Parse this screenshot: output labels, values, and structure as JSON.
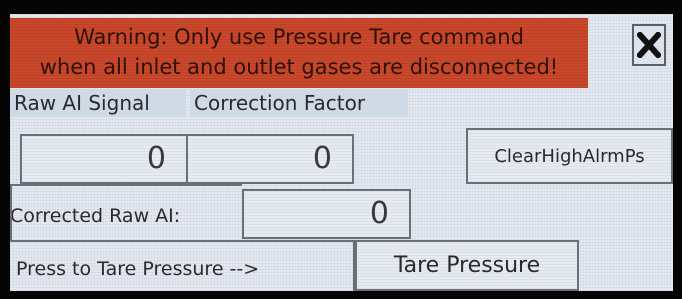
{
  "warning": {
    "line1": "Warning: Only use Pressure Tare command",
    "line2": "when all inlet and outlet gases are disconnected!"
  },
  "close_icon": "close-x-icon",
  "headers": {
    "raw_ai_signal": "Raw AI Signal",
    "correction_factor": "Correction Factor"
  },
  "values": {
    "raw_ai_signal": "0",
    "correction_factor": "0",
    "corrected_raw_ai": "0"
  },
  "buttons": {
    "clear_high_alarm": "ClearHighAlrmPs",
    "tare_pressure": "Tare Pressure"
  },
  "labels": {
    "corrected_raw_ai": "Corrected Raw AI:",
    "press_to_tare": "Press to Tare Pressure -->"
  },
  "colors": {
    "warning_bg": "#c9472a",
    "panel_bg": "#e4e9f1",
    "border": "#6a6f78"
  }
}
